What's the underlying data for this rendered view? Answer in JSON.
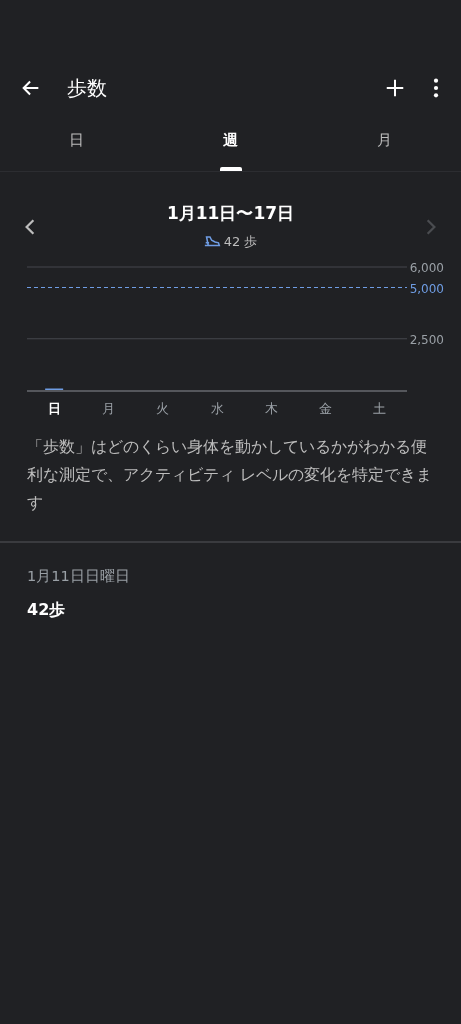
{
  "app_bar": {
    "title": "歩数"
  },
  "tabs": [
    {
      "label": "日",
      "selected": false
    },
    {
      "label": "週",
      "selected": true
    },
    {
      "label": "月",
      "selected": false
    }
  ],
  "period": {
    "title": "1月11日〜17日",
    "total": "42 歩",
    "previous_enabled": true,
    "next_enabled": false
  },
  "chart": {
    "day_selected": [
      true,
      false,
      false,
      false,
      false,
      false,
      false
    ],
    "chart_data": {
      "type": "bar",
      "categories": [
        "日",
        "月",
        "火",
        "水",
        "木",
        "金",
        "土"
      ],
      "series": [
        {
          "color": "#6f9de4",
          "values": [
            42,
            null,
            null,
            null,
            null,
            null,
            null
          ]
        }
      ],
      "ylim": [
        0,
        6000
      ],
      "yticks": [
        {
          "value": 2500,
          "label": "2,500"
        },
        {
          "value": 6000,
          "label": "6,000"
        }
      ],
      "ref_lines": [
        {
          "axis": "y",
          "value": 5000,
          "label": "5,000",
          "color": "#6f9de4"
        }
      ]
    }
  },
  "description": "「歩数」はどのくらい身体を動かしているかがわかる便利な測定で、アクティビティ レベルの変化を特定できます",
  "entries": [
    {
      "date": "1月11日日曜日",
      "value": "42歩"
    }
  ]
}
